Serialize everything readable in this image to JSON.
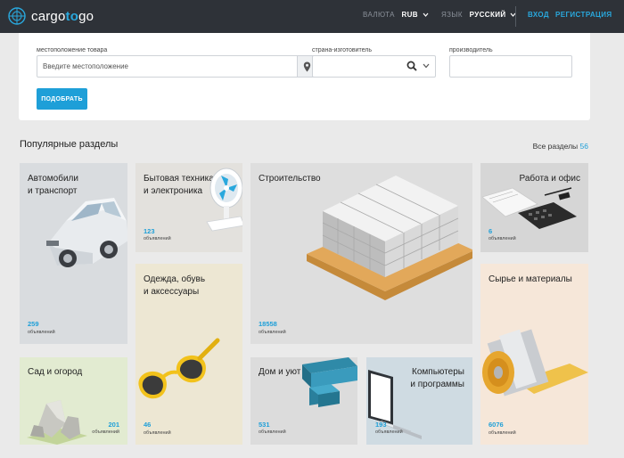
{
  "header": {
    "logo_text_1": "cargo",
    "logo_text_2": "to",
    "logo_text_3": "go",
    "currency_label": "ВАЛЮТА",
    "currency_value": "RUB",
    "language_label": "ЯЗЫК",
    "language_value": "РУССКИЙ",
    "login": "ВХОД",
    "register": "РЕГИСТРАЦИЯ"
  },
  "search": {
    "location_label": "местоположение товара",
    "location_placeholder": "Введите местоположение",
    "country_label": "страна-изготовитель",
    "manufacturer_label": "производитель",
    "submit": "ПОДОБРАТЬ"
  },
  "section": {
    "title": "Популярные разделы",
    "all_label": "Все разделы",
    "all_count": "56"
  },
  "unit": "объявлений",
  "tiles": {
    "auto": {
      "title_1": "Автомобили",
      "title_2": "и транспорт",
      "count": "259"
    },
    "appliances": {
      "title_1": "Бытовая техника",
      "title_2": "и электроника",
      "count": "123"
    },
    "construction": {
      "title_1": "Строительство",
      "count": "18558"
    },
    "work": {
      "title_1": "Работа и офис",
      "count": "6"
    },
    "clothes": {
      "title_1": "Одежда, обувь",
      "title_2": "и аксессуары",
      "count": "46"
    },
    "raw": {
      "title_1": "Сырье и материалы",
      "count": "6076"
    },
    "garden": {
      "title_1": "Сад и огород",
      "count": "201"
    },
    "home": {
      "title_1": "Дом и уют",
      "count": "531"
    },
    "computers": {
      "title_1": "Компьютеры",
      "title_2": "и программы",
      "count": "193"
    }
  },
  "colors": {
    "topbar": "#2e3238",
    "accent": "#1e9fd8"
  }
}
